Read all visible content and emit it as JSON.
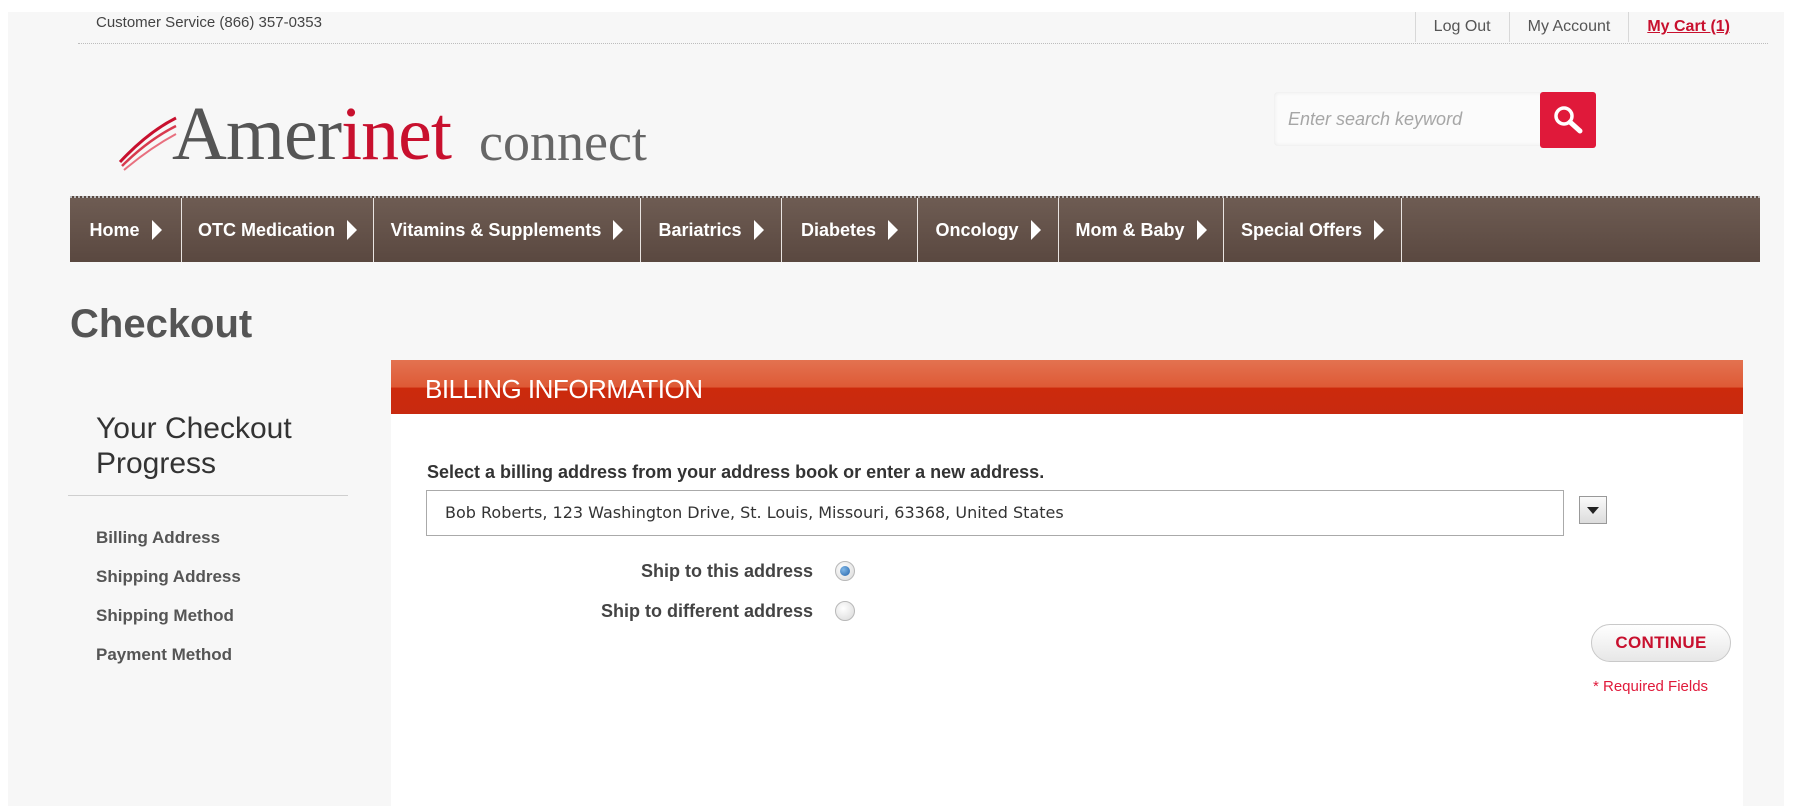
{
  "topbar": {
    "customer_service": "Customer Service (866) 357-0353",
    "log_out": "Log Out",
    "my_account": "My Account",
    "my_cart": "My Cart (1)"
  },
  "logo": {
    "amer": "Amer",
    "inet": "inet",
    "connect": "connect"
  },
  "search": {
    "placeholder": "Enter search keyword",
    "icon": "search-icon",
    "button_color": "#e0193a"
  },
  "nav": {
    "items": [
      {
        "label": "Home"
      },
      {
        "label": "OTC Medication"
      },
      {
        "label": "Vitamins & Supplements"
      },
      {
        "label": "Bariatrics"
      },
      {
        "label": "Diabetes"
      },
      {
        "label": "Oncology"
      },
      {
        "label": "Mom & Baby"
      },
      {
        "label": "Special Offers"
      }
    ]
  },
  "page": {
    "title": "Checkout"
  },
  "sidebar": {
    "title": "Your Checkout Progress",
    "steps": [
      {
        "label": "Billing Address"
      },
      {
        "label": "Shipping Address"
      },
      {
        "label": "Shipping Method"
      },
      {
        "label": "Payment Method"
      }
    ]
  },
  "billing": {
    "header": "BILLING INFORMATION",
    "instruction": "Select a billing address from your address book or enter a new address.",
    "selected_address": "Bob Roberts, 123 Washington Drive, St. Louis, Missouri, 63368, United States",
    "options": [
      {
        "label": "Ship to this address",
        "checked": true
      },
      {
        "label": "Ship to different address",
        "checked": false
      }
    ],
    "continue_label": "CONTINUE",
    "required_note": "* Required Fields"
  },
  "colors": {
    "brand_red": "#c8102e",
    "nav_brown": "#5f4d45",
    "header_orange": "#d9481f"
  }
}
